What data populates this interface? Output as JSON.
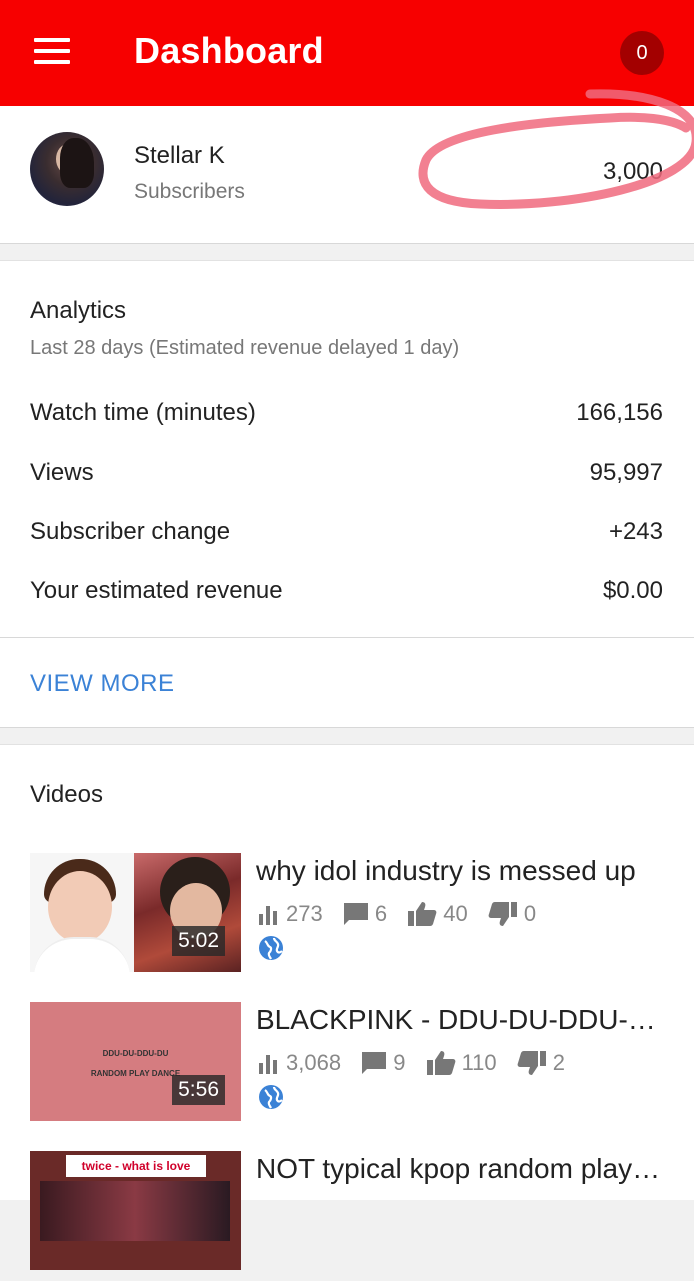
{
  "app": {
    "title": "Dashboard",
    "notifications": "0"
  },
  "channel": {
    "name": "Stellar K",
    "sub_label": "Subscribers",
    "sub_count": "3,000"
  },
  "analytics": {
    "title": "Analytics",
    "subtitle": "Last 28 days (Estimated revenue delayed 1 day)",
    "rows": [
      {
        "label": "Watch time (minutes)",
        "value": "166,156"
      },
      {
        "label": "Views",
        "value": "95,997"
      },
      {
        "label": "Subscriber change",
        "value": "+243"
      },
      {
        "label": "Your estimated revenue",
        "value": "$0.00"
      }
    ],
    "view_more": "VIEW MORE"
  },
  "videos": {
    "title": "Videos",
    "items": [
      {
        "title": "why idol industry is messed up",
        "duration": "5:02",
        "views": "273",
        "comments": "6",
        "likes": "40",
        "dislikes": "0",
        "thumb_text": ""
      },
      {
        "title": "BLACKPINK - DDU-DU-DDU-DU RANDOM PLAY DANCE",
        "duration": "5:56",
        "views": "3,068",
        "comments": "9",
        "likes": "110",
        "dislikes": "2",
        "thumb_text": "DDU-DU-DDU-DU\nRANDOM PLAY DANCE"
      },
      {
        "title": "NOT typical kpop random play dance",
        "duration": "",
        "views": "",
        "comments": "",
        "likes": "",
        "dislikes": "",
        "thumb_text": "twice - what is love"
      }
    ]
  },
  "colors": {
    "appbar": "#f70000",
    "accent_link": "#3b82d6",
    "badge": "#a30000",
    "annotation": "#f06a7e"
  }
}
